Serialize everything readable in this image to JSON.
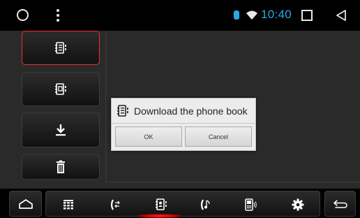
{
  "status_bar": {
    "time": "10:40",
    "icons": [
      "circle-home-icon",
      "overflow-menu-icon",
      "bluetooth-icon",
      "wifi-icon",
      "recents-square-icon",
      "back-triangle-icon"
    ],
    "time_color": "#2aa8e0"
  },
  "sidebar": {
    "items": [
      {
        "name": "phonebook-icon",
        "active": true
      },
      {
        "name": "phonebook-sync-icon",
        "active": false
      },
      {
        "name": "download-icon",
        "active": false
      },
      {
        "name": "trash-icon",
        "active": false
      }
    ],
    "active_border_color": "#d9352f"
  },
  "dialog": {
    "title": "Download the phone book",
    "icon": "phonebook-icon",
    "ok_label": "OK",
    "cancel_label": "Cancel"
  },
  "dock": {
    "items": [
      "home-icon",
      "dialpad-icon",
      "call-log-icon",
      "contacts-icon",
      "music-phone-icon",
      "device-icon",
      "settings-gear-icon",
      "return-arrow-icon"
    ],
    "active_item": "contacts-icon",
    "active_glow_color": "#ff2a2a"
  }
}
